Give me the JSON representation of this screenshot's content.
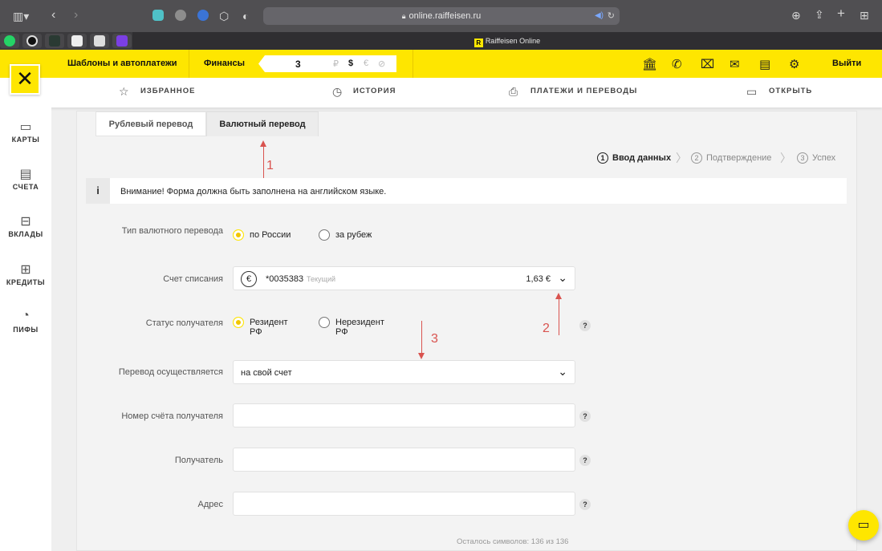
{
  "browser": {
    "url": "online.raiffeisen.ru",
    "active_tab_title": "Raiffeisen Online",
    "active_tab_favicon": "R"
  },
  "header": {
    "templates": "Шаблоны и автоплатежи",
    "finance": "Финансы",
    "finance_value": "3",
    "currencies": [
      "₽",
      "$",
      "€",
      "⊘"
    ],
    "logout": "Выйти"
  },
  "subnav": {
    "favorites": "ИЗБРАННОЕ",
    "history": "ИСТОРИЯ",
    "payments": "ПЛАТЕЖИ И ПЕРЕВОДЫ",
    "open": "ОТКРЫТЬ"
  },
  "sidebar": {
    "items": [
      {
        "label": "КАРТЫ",
        "icon": "cards-icon"
      },
      {
        "label": "СЧЕТА",
        "icon": "accounts-icon"
      },
      {
        "label": "ВКЛАДЫ",
        "icon": "deposits-icon"
      },
      {
        "label": "КРЕДИТЫ",
        "icon": "credits-icon"
      },
      {
        "label": "ПИФЫ",
        "icon": "funds-icon"
      }
    ]
  },
  "tabs": {
    "ruble": "Рублевый перевод",
    "currency": "Валютный перевод"
  },
  "steps": [
    {
      "num": "1",
      "label": "Ввод данных"
    },
    {
      "num": "2",
      "label": "Подтверждение"
    },
    {
      "num": "3",
      "label": "Успех"
    }
  ],
  "info": "Внимание! Форма должна быть заполнена на английском языке.",
  "form": {
    "transfer_type_label": "Тип валютного перевода",
    "transfer_type_options": [
      "по России",
      "за рубеж"
    ],
    "account_label": "Счет списания",
    "account_number": "*0035383",
    "account_type": "Текущий",
    "account_balance": "1,63 €",
    "recipient_status_label": "Статус получателя",
    "status_options": [
      "Резидент\nРФ",
      "Нерезидент\nРФ"
    ],
    "transfer_mode_label": "Перевод осуществляется",
    "transfer_mode_value": "на свой счет",
    "recipient_account_label": "Номер счёта получателя",
    "recipient_label": "Получатель",
    "address_label": "Адрес",
    "chars_left": "Осталось символов: 136 из 136"
  },
  "annotations": [
    "1",
    "2",
    "3"
  ],
  "colors": {
    "brand_yellow": "#fee600",
    "annotation_red": "#d9534f"
  }
}
